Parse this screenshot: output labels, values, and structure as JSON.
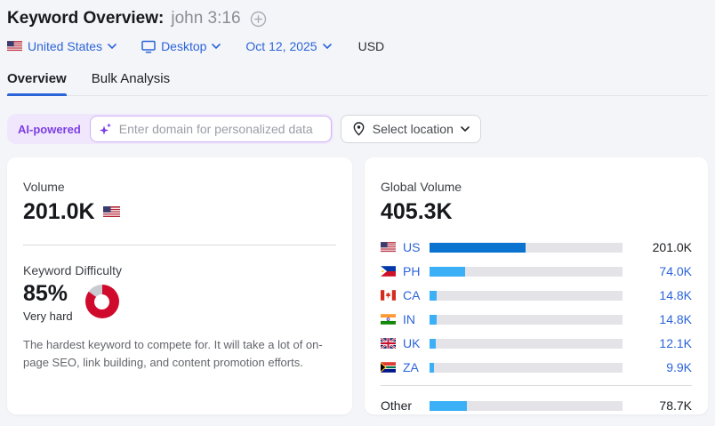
{
  "header": {
    "title": "Keyword Overview:",
    "keyword": "john 3:16"
  },
  "filters": {
    "country": "United States",
    "device": "Desktop",
    "date": "Oct 12, 2025",
    "currency": "USD"
  },
  "tabs": {
    "overview": "Overview",
    "bulk": "Bulk Analysis"
  },
  "ai_bar": {
    "badge": "AI-powered",
    "input_placeholder": "Enter domain for personalized data",
    "location_button": "Select location"
  },
  "volume_card": {
    "volume_label": "Volume",
    "volume_value": "201.0K",
    "kd_label": "Keyword Difficulty",
    "kd_value": "85%",
    "kd_percent": 85,
    "kd_level": "Very hard",
    "kd_description": "The hardest keyword to compete for. It will take a lot of on-page SEO, link building, and content promotion efforts."
  },
  "global_card": {
    "label": "Global Volume",
    "value": "405.3K",
    "rows": [
      {
        "code": "US",
        "value": "201.0K",
        "pct": 49.6
      },
      {
        "code": "PH",
        "value": "74.0K",
        "pct": 18.3
      },
      {
        "code": "CA",
        "value": "14.8K",
        "pct": 3.7
      },
      {
        "code": "IN",
        "value": "14.8K",
        "pct": 3.7
      },
      {
        "code": "UK",
        "value": "12.1K",
        "pct": 3.0
      },
      {
        "code": "ZA",
        "value": "9.9K",
        "pct": 2.4
      }
    ],
    "other": {
      "label": "Other",
      "value": "78.7K",
      "pct": 19.4
    }
  },
  "colors": {
    "link_blue": "#2b64d9",
    "bar_dark_blue": "#0a73cf",
    "bar_light_blue": "#3bb0f7",
    "bar_track": "#e4e4e8",
    "kd_red": "#d00a2c",
    "kd_remainder": "#c9cbd0",
    "ai_purple": "#7c3fe4",
    "ai_purple_bg": "#f1e7fd",
    "page_bg": "#f4f5f8"
  }
}
